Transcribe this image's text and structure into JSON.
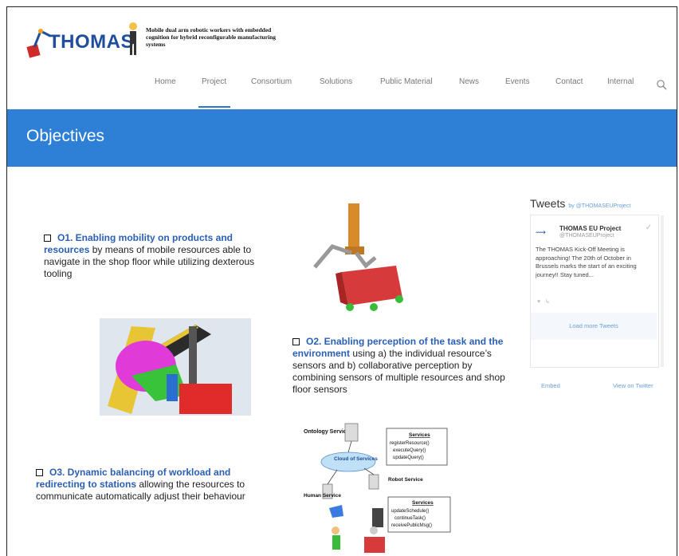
{
  "logo": {
    "word": "THOMAS",
    "tagline": "Mobile dual arm robotic workers with embedded cognition for hybrid reconfigurable manufacturing systems"
  },
  "nav": {
    "items": [
      {
        "label": "Home"
      },
      {
        "label": "Project"
      },
      {
        "label": "Consortium"
      },
      {
        "label": "Solutions"
      },
      {
        "label": "Public Material"
      },
      {
        "label": "News"
      },
      {
        "label": "Events"
      },
      {
        "label": "Contact"
      },
      {
        "label": "Internal"
      }
    ],
    "active": "Project",
    "search_icon": "search-icon"
  },
  "banner": {
    "title": "Objectives"
  },
  "objectives": {
    "o1": {
      "lead": "O1. Enabling mobility on products and resources",
      "rest": " by means of mobile resources able to navigate in the shop floor while utilizing dexterous tooling"
    },
    "o2": {
      "lead": "O2. Enabling perception of the task and the environment",
      "rest": " using a) the individual resource’s sensors and b) collaborative perception by combining sensors of multiple resources and shop floor sensors"
    },
    "o3": {
      "lead": "O3. Dynamic balancing  of workload and redirecting to stations",
      "rest": " allowing the resources to communicate automatically adjust their behaviour"
    }
  },
  "diagram": {
    "ontology": "Ontology Service",
    "services_top": {
      "title": "Services",
      "items": [
        "registerResource()",
        "executeQuery()",
        "updateQuery()"
      ]
    },
    "cloud": "Cloud of Services",
    "robot": "Robot Service",
    "human": "Human Service",
    "services_bottom": {
      "title": "Services",
      "items": [
        "updateSchedule()",
        "continueTask()",
        "receivePublicMsg()"
      ]
    }
  },
  "tweets": {
    "title": "Tweets",
    "by": "by @THOMASEUProject",
    "name": "THOMAS EU Project",
    "handle": "@THOMASEUProject",
    "text": "The THOMAS Kick-Off Meeting is approaching! The 20th of October in Brussels marks the start of an exciting journey!! Stay tuned...",
    "load_more": "Load more Tweets",
    "embed": "Embed",
    "view": "View on Twitter"
  }
}
